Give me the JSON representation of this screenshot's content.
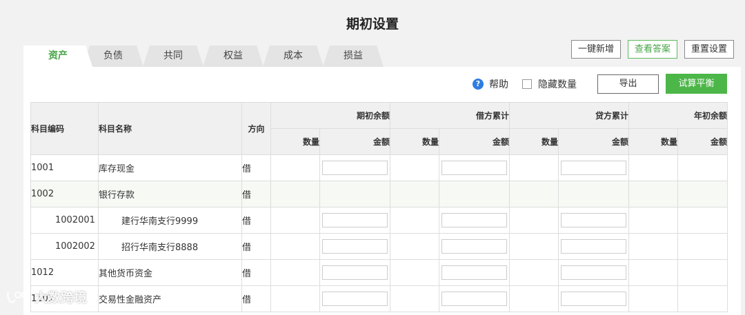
{
  "page": {
    "title": "期初设置"
  },
  "actions": [
    {
      "label": "一键新增"
    },
    {
      "label": "查看答案"
    },
    {
      "label": "重置设置"
    }
  ],
  "tabs": [
    {
      "label": "资产",
      "active": true
    },
    {
      "label": "负债"
    },
    {
      "label": "共同"
    },
    {
      "label": "权益"
    },
    {
      "label": "成本"
    },
    {
      "label": "损益"
    }
  ],
  "toolbar": {
    "help_icon": "question-circle-icon",
    "help_label": "帮助",
    "hide_qty_label": "隐藏数量",
    "hide_qty_checked": false,
    "export_label": "导出",
    "trial_balance_label": "试算平衡"
  },
  "table": {
    "col_code": "科目编码",
    "col_name": "科目名称",
    "col_direction": "方向",
    "groups": [
      "期初余额",
      "借方累计",
      "贷方累计",
      "年初余额"
    ],
    "sub_qty": "数量",
    "sub_amount": "金额",
    "rows": [
      {
        "code": "1001",
        "name": "库存现金",
        "direction": "借"
      },
      {
        "code": "1002",
        "name": "银行存款",
        "direction": "借"
      },
      {
        "code": "1002001",
        "name": "建行华南支行9999",
        "direction": "借"
      },
      {
        "code": "1002002",
        "name": "招行华南支行8888",
        "direction": "借"
      },
      {
        "code": "1012",
        "name": "其他货币资金",
        "direction": "借"
      },
      {
        "code": "1101",
        "name": "交易性金融资产",
        "direction": "借"
      }
    ]
  },
  "watermark": {
    "text": "大数跨境",
    "icon": "brand-logo-icon"
  },
  "colors": {
    "accent_green": "#4cb648",
    "help_blue": "#2f7de1"
  }
}
